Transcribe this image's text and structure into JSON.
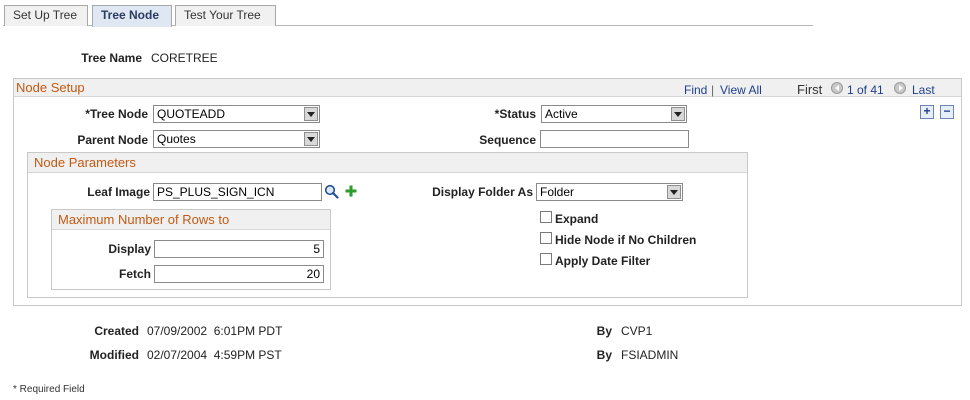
{
  "tabs": [
    {
      "label": "Set Up Tree",
      "accesskey": "S"
    },
    {
      "label": "Tree Node",
      "accesskey": ""
    },
    {
      "label": "Test Your Tree",
      "accesskey": "T"
    }
  ],
  "tree_name": {
    "label": "Tree Name",
    "value": "CORETREE"
  },
  "node_setup": {
    "title": "Node Setup",
    "nav": {
      "find": "Find",
      "separator": "|",
      "view_all": "View All",
      "first": "First",
      "counter": "1 of 41",
      "last": "Last"
    },
    "add_icon": "+",
    "remove_icon": "−",
    "tree_node": {
      "label": "*Tree Node",
      "value": "QUOTEADD"
    },
    "parent_node": {
      "label": "Parent Node",
      "value": "Quotes"
    },
    "status": {
      "label": "*Status",
      "value": "Active"
    },
    "sequence": {
      "label": "Sequence",
      "value": ""
    }
  },
  "node_parameters": {
    "title": "Node Parameters",
    "leaf_image": {
      "label": "Leaf Image",
      "value": "PS_PLUS_SIGN_ICN"
    },
    "display_folder_as": {
      "label": "Display Folder As",
      "value": "Folder"
    },
    "max_rows": {
      "title": "Maximum Number of Rows to",
      "display": {
        "label": "Display",
        "value": "5"
      },
      "fetch": {
        "label": "Fetch",
        "value": "20"
      }
    },
    "checkboxes": {
      "expand": {
        "label": "Expand",
        "checked": false
      },
      "hide_node": {
        "label": "Hide Node if No Children",
        "checked": false
      },
      "apply_date_filter": {
        "label": "Apply Date Filter",
        "checked": false
      }
    }
  },
  "audit": {
    "created": {
      "label": "Created",
      "value": "07/09/2002  6:01PM PDT",
      "by_label": "By",
      "by_value": "CVP1"
    },
    "modified": {
      "label": "Modified",
      "value": "02/07/2004  4:59PM PST",
      "by_label": "By",
      "by_value": "FSIADMIN"
    }
  },
  "footer_note": "* Required Field",
  "colors": {
    "accent_orange": "#c25a12",
    "link_blue": "#1e3f8a",
    "add_green": "#2e9b2e"
  }
}
